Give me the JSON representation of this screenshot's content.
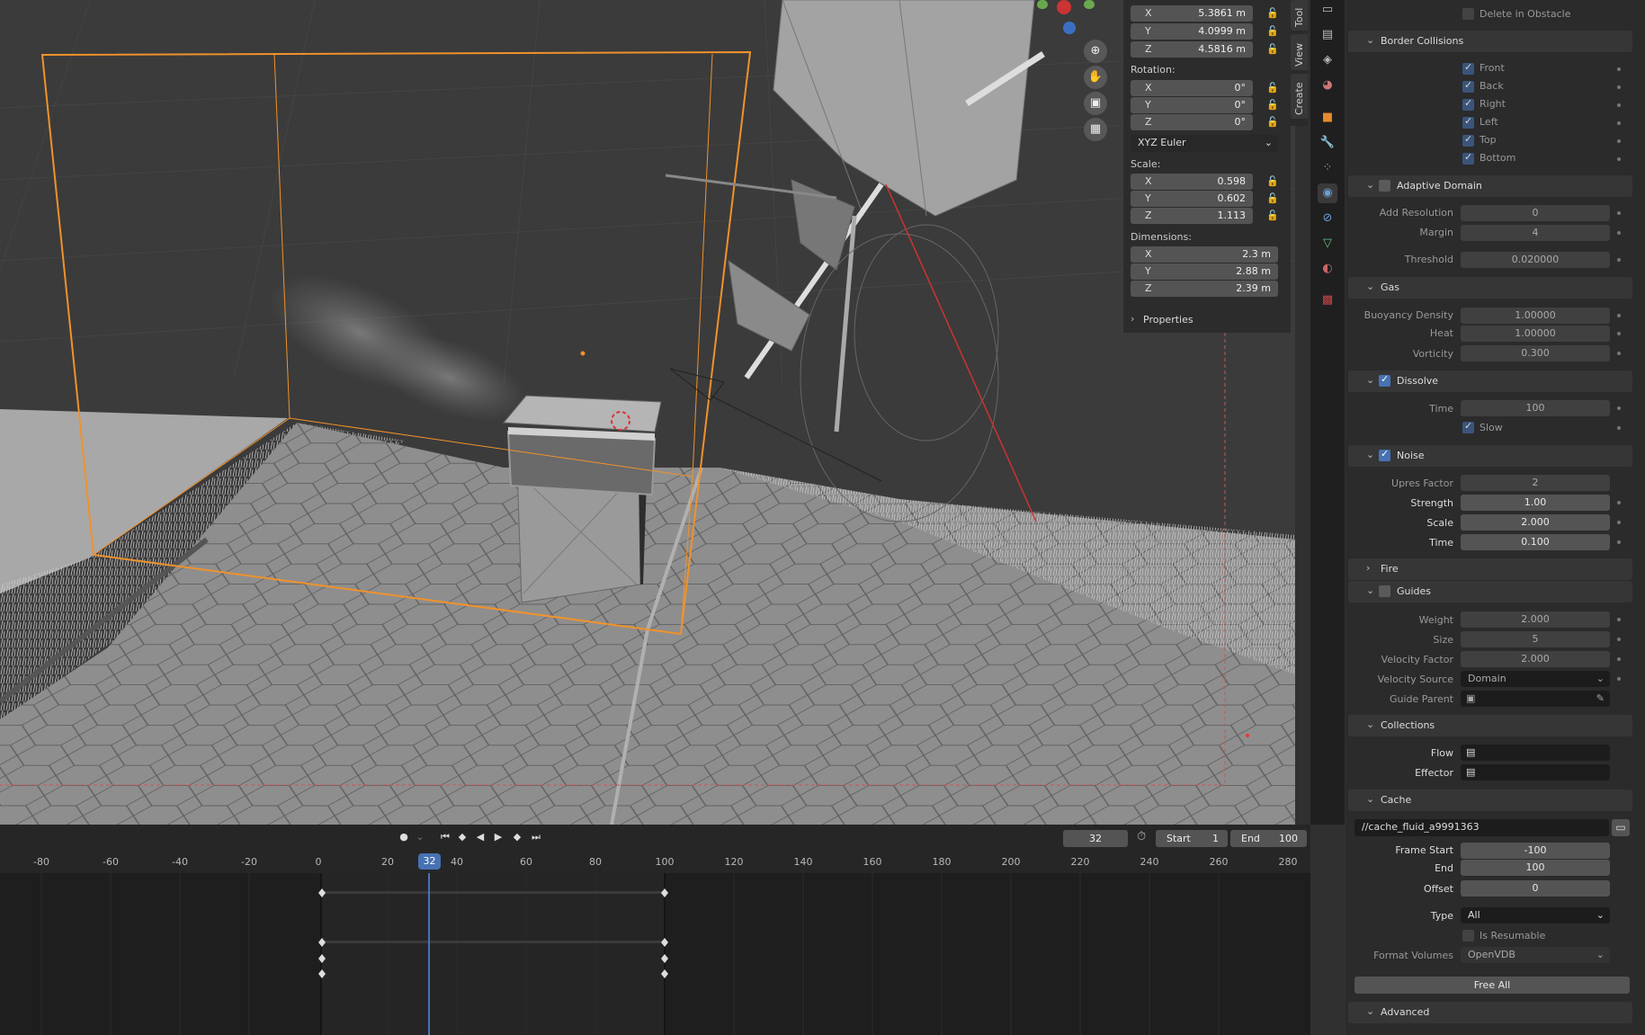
{
  "npanel": {
    "location": [
      {
        "axis": "X",
        "value": "5.3861 m"
      },
      {
        "axis": "Y",
        "value": "4.0999 m"
      },
      {
        "axis": "Z",
        "value": "4.5816 m"
      }
    ],
    "rotation_label": "Rotation:",
    "rotation": [
      {
        "axis": "X",
        "value": "0°"
      },
      {
        "axis": "Y",
        "value": "0°"
      },
      {
        "axis": "Z",
        "value": "0°"
      }
    ],
    "rotation_mode": "XYZ Euler",
    "scale_label": "Scale:",
    "scale": [
      {
        "axis": "X",
        "value": "0.598"
      },
      {
        "axis": "Y",
        "value": "0.602"
      },
      {
        "axis": "Z",
        "value": "1.113"
      }
    ],
    "dimensions_label": "Dimensions:",
    "dimensions": [
      {
        "axis": "X",
        "value": "2.3 m"
      },
      {
        "axis": "Y",
        "value": "2.88 m"
      },
      {
        "axis": "Z",
        "value": "2.39 m"
      }
    ],
    "properties_label": "Properties"
  },
  "sidebar_tabs": [
    "Tool",
    "View",
    "Create"
  ],
  "props": {
    "delete_in_obstacle": "Delete in Obstacle",
    "border_collisions": {
      "title": "Border Collisions",
      "items": [
        "Front",
        "Back",
        "Right",
        "Left",
        "Top",
        "Bottom"
      ]
    },
    "adaptive_domain": {
      "title": "Adaptive Domain",
      "add_resolution_label": "Add Resolution",
      "add_resolution": "0",
      "margin_label": "Margin",
      "margin": "4",
      "threshold_label": "Threshold",
      "threshold": "0.020000"
    },
    "gas": {
      "title": "Gas",
      "buoyancy_label": "Buoyancy Density",
      "buoyancy": "1.00000",
      "heat_label": "Heat",
      "heat": "1.00000",
      "vorticity_label": "Vorticity",
      "vorticity": "0.300"
    },
    "dissolve": {
      "title": "Dissolve",
      "time_label": "Time",
      "time": "100",
      "slow_label": "Slow"
    },
    "noise": {
      "title": "Noise",
      "upres_label": "Upres Factor",
      "upres": "2",
      "strength_label": "Strength",
      "strength": "1.00",
      "scale_label": "Scale",
      "scale": "2.000",
      "time_label": "Time",
      "time": "0.100"
    },
    "fire": {
      "title": "Fire"
    },
    "guides": {
      "title": "Guides",
      "weight_label": "Weight",
      "weight": "2.000",
      "size_label": "Size",
      "size": "5",
      "velocity_factor_label": "Velocity Factor",
      "velocity_factor": "2.000",
      "velocity_source_label": "Velocity Source",
      "velocity_source": "Domain",
      "guide_parent_label": "Guide Parent"
    },
    "collections": {
      "title": "Collections",
      "flow_label": "Flow",
      "effector_label": "Effector"
    },
    "cache": {
      "title": "Cache",
      "path": "//cache_fluid_a9991363",
      "frame_start_label": "Frame Start",
      "frame_start": "-100",
      "end_label": "End",
      "end": "100",
      "offset_label": "Offset",
      "offset": "0",
      "type_label": "Type",
      "type": "All",
      "resumable_label": "Is Resumable",
      "format_volumes_label": "Format Volumes",
      "format_volumes": "OpenVDB",
      "free_all": "Free All"
    },
    "advanced": {
      "title": "Advanced"
    }
  },
  "timeline": {
    "current_frame": "32",
    "start_label": "Start",
    "start": "1",
    "end_label": "End",
    "end": "100",
    "ticks": [
      "-80",
      "-60",
      "-40",
      "-20",
      "0",
      "20",
      "40",
      "60",
      "80",
      "100",
      "120",
      "140",
      "160",
      "180",
      "200",
      "220",
      "240",
      "260",
      "280"
    ],
    "playhead": "32"
  },
  "colors": {
    "accent": "#4772b3",
    "selection_orange": "#f0922b",
    "viewport_bg": "#3b3b3b",
    "panel_bg": "#2b2b2b"
  }
}
